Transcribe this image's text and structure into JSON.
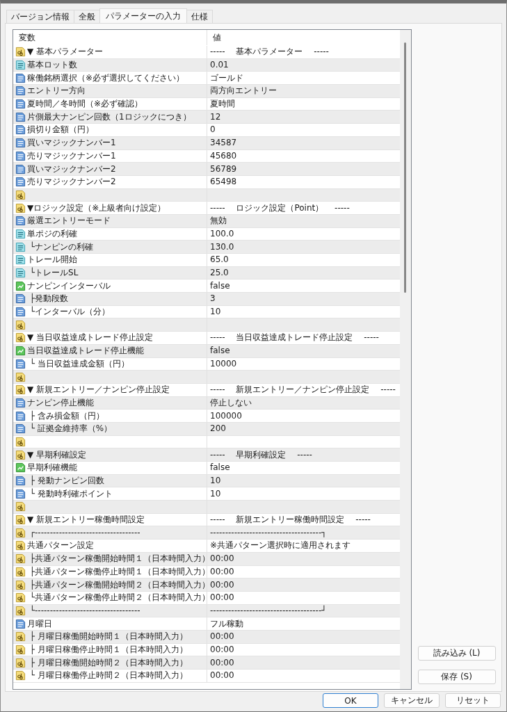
{
  "tabs": [
    {
      "label": "バージョン情報",
      "selected": false
    },
    {
      "label": "全般",
      "selected": false
    },
    {
      "label": "パラメーターの入力",
      "selected": true
    },
    {
      "label": "仕様",
      "selected": false
    }
  ],
  "table": {
    "columns": [
      "変数",
      "値"
    ],
    "rows": [
      {
        "kind": "string",
        "name": "▼ 基本パラメーター",
        "value": "-----　 基本パラメーター　 -----"
      },
      {
        "kind": "double",
        "name": "基本ロット数",
        "value": "0.01"
      },
      {
        "kind": "int",
        "name": "稼働銘柄選択（※必ず選択してください）",
        "value": "ゴールド"
      },
      {
        "kind": "int",
        "name": "エントリー方向",
        "value": "両方向エントリー"
      },
      {
        "kind": "int",
        "name": "夏時間／冬時間（※必ず確認）",
        "value": "夏時間"
      },
      {
        "kind": "int",
        "name": "片側最大ナンピン回数（1ロジックにつき）",
        "value": "12"
      },
      {
        "kind": "int",
        "name": "損切り金額（円）",
        "value": "0"
      },
      {
        "kind": "int",
        "name": "買いマジックナンバー1",
        "value": "34587"
      },
      {
        "kind": "int",
        "name": "売りマジックナンバー1",
        "value": "45680"
      },
      {
        "kind": "int",
        "name": "買いマジックナンバー2",
        "value": "56789"
      },
      {
        "kind": "int",
        "name": "売りマジックナンバー2",
        "value": "65498"
      },
      {
        "kind": "string"
      },
      {
        "kind": "string",
        "name": "▼ロジック設定（※上級者向け設定）",
        "value": "-----　 ロジック設定（Point）　 -----"
      },
      {
        "kind": "int",
        "name": "厳選エントリーモード",
        "value": "無効"
      },
      {
        "kind": "double",
        "name": "単ポジの利確",
        "value": "100.0"
      },
      {
        "kind": "double",
        "name": " └ナンピンの利確",
        "value": "130.0"
      },
      {
        "kind": "double",
        "name": "トレール開始",
        "value": "65.0"
      },
      {
        "kind": "double",
        "name": " └トレールSL",
        "value": "25.0"
      },
      {
        "kind": "bool",
        "name": "ナンピンインターバル",
        "value": "false"
      },
      {
        "kind": "int",
        "name": " ├発動段数",
        "value": "3"
      },
      {
        "kind": "int",
        "name": " └インターバル（分）",
        "value": "10"
      },
      {
        "kind": "string"
      },
      {
        "kind": "string",
        "name": "▼ 当日収益達成トレード停止設定",
        "value": "-----　 当日収益達成トレード停止設定　 -----"
      },
      {
        "kind": "bool",
        "name": "当日収益達成トレード停止機能",
        "value": "false"
      },
      {
        "kind": "int",
        "name": " └ 当日収益達成金額（円）",
        "value": "10000"
      },
      {
        "kind": "string"
      },
      {
        "kind": "string",
        "name": "▼ 新規エントリー／ナンピン停止設定",
        "value": "-----　 新規エントリー／ナンピン停止設定　 -----"
      },
      {
        "kind": "int",
        "name": "ナンピン停止機能",
        "value": "停止しない"
      },
      {
        "kind": "int",
        "name": " ├ 含み損金額（円）",
        "value": "100000"
      },
      {
        "kind": "int",
        "name": " └ 証拠金維持率（%）",
        "value": "200"
      },
      {
        "kind": "string"
      },
      {
        "kind": "string",
        "name": "▼ 早期利確設定",
        "value": "-----　 早期利確設定　 -----"
      },
      {
        "kind": "bool",
        "name": "早期利確機能",
        "value": "false"
      },
      {
        "kind": "int",
        "name": " ├ 発動ナンピン回数",
        "value": "10"
      },
      {
        "kind": "int",
        "name": " └ 発動時利確ポイント",
        "value": "10"
      },
      {
        "kind": "string"
      },
      {
        "kind": "string",
        "name": "▼ 新規エントリー稼働時間設定",
        "value": "-----　 新規エントリー稼働時間設定　 -----"
      },
      {
        "kind": "string",
        "name": " ┌-----------------------------------",
        "value": "-------------------------------------┐"
      },
      {
        "kind": "string",
        "name": "共通パターン設定",
        "value": "※共通パターン選択時に適用されます"
      },
      {
        "kind": "string",
        "name": " ├共通パターン稼働開始時間１（日本時間入力）",
        "value": "00:00"
      },
      {
        "kind": "string",
        "name": " ├共通パターン稼働停止時間１（日本時間入力）",
        "value": "00:00"
      },
      {
        "kind": "string",
        "name": " ├共通パターン稼働開始時間２（日本時間入力）",
        "value": "00:00"
      },
      {
        "kind": "string",
        "name": " └共通パターン稼働停止時間２（日本時間入力）",
        "value": "00:00"
      },
      {
        "kind": "string",
        "name": " └-----------------------------------",
        "value": "-------------------------------------┘"
      },
      {
        "kind": "int",
        "name": "月曜日",
        "value": "フル稼動"
      },
      {
        "kind": "string",
        "name": " ├ 月曜日稼働開始時間１（日本時間入力）",
        "value": "00:00"
      },
      {
        "kind": "string",
        "name": " ├ 月曜日稼働停止時間１（日本時間入力）",
        "value": "00:00"
      },
      {
        "kind": "string",
        "name": " ├ 月曜日稼働開始時間２（日本時間入力）",
        "value": "00:00"
      },
      {
        "kind": "string",
        "name": " └ 月曜日稼働停止時間２（日本時間入力）",
        "value": "00:00"
      }
    ]
  },
  "side_buttons": [
    "読み込み (L)",
    "保存 (S)"
  ],
  "buttons": [
    {
      "label": "OK",
      "default": true
    },
    {
      "label": "キャンセル",
      "default": false
    },
    {
      "label": "リセット",
      "default": false
    }
  ]
}
